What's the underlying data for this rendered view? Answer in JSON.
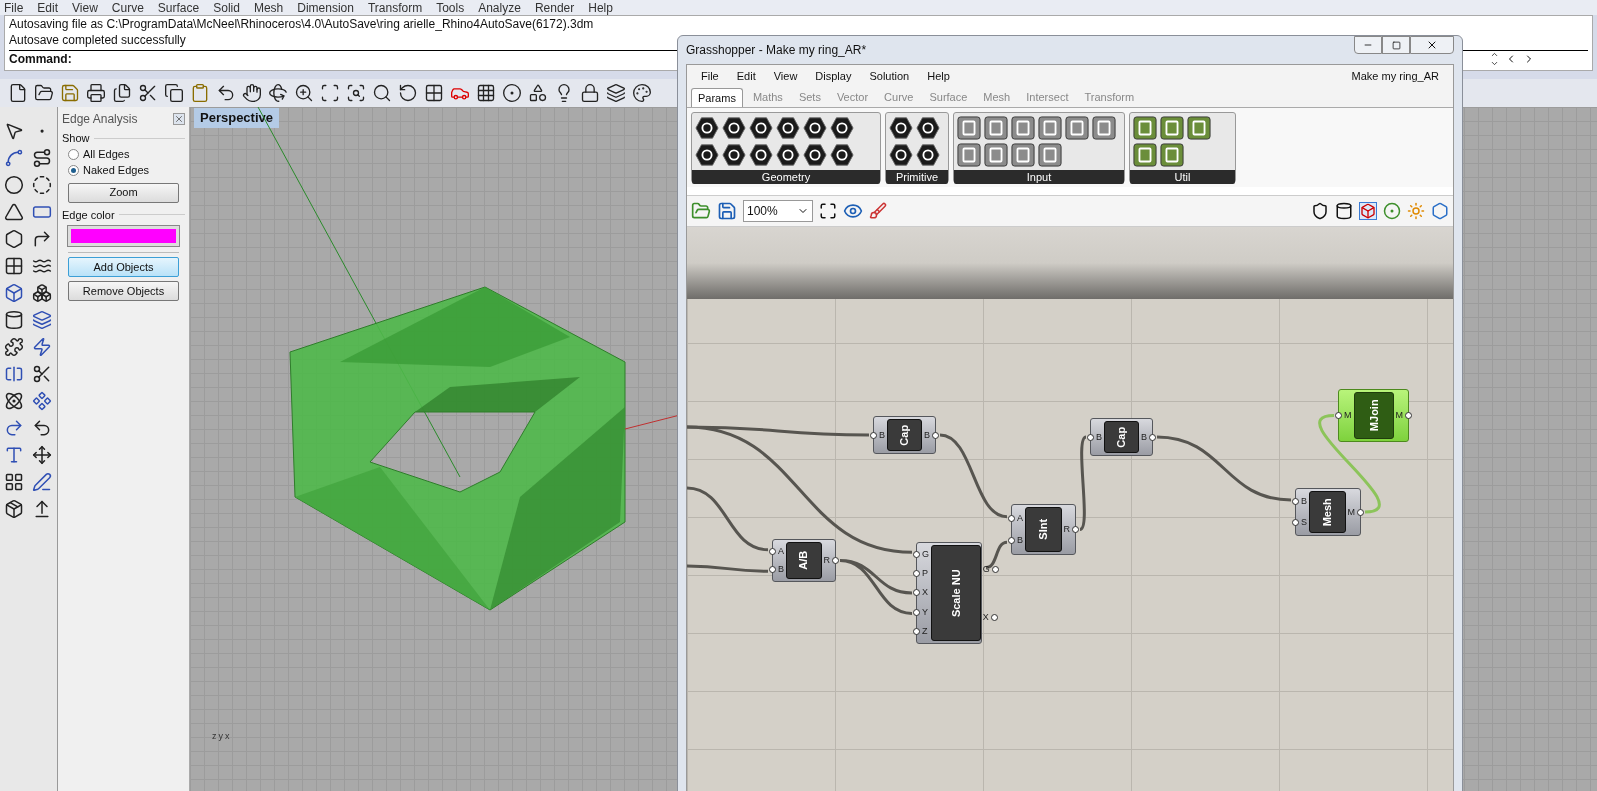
{
  "menu_bar": [
    "File",
    "Edit",
    "View",
    "Curve",
    "Surface",
    "Solid",
    "Mesh",
    "Dimension",
    "Transform",
    "Tools",
    "Analyze",
    "Render",
    "Help"
  ],
  "command_history": [
    "Autosaving file as C:\\ProgramData\\McNeel\\Rhinoceros\\4.0\\AutoSave\\ring arielle_Rhino4AutoSave(6172).3dm",
    "Autosave completed successfully"
  ],
  "command_prompt": "Command:",
  "edge_analysis": {
    "title": "Edge Analysis",
    "show_label": "Show",
    "options": [
      {
        "label": "All Edges",
        "selected": false
      },
      {
        "label": "Naked Edges",
        "selected": true
      }
    ],
    "zoom_button": "Zoom",
    "edge_color_label": "Edge color",
    "edge_color_swatch": {
      "color": "#ff00ff"
    },
    "buttons": [
      {
        "label": "Add Objects",
        "focused": true
      },
      {
        "label": "Remove Objects",
        "focused": false
      }
    ]
  },
  "viewport": {
    "title": "Perspective",
    "axes": [
      "z",
      "y",
      "x"
    ]
  },
  "grasshopper": {
    "title": "Grasshopper - Make my ring_AR*",
    "menu": [
      "File",
      "Edit",
      "View",
      "Display",
      "Solution",
      "Help"
    ],
    "document_name": "Make my ring_AR",
    "tabs": [
      {
        "label": "Params",
        "selected": true
      },
      {
        "label": "Maths",
        "selected": false
      },
      {
        "label": "Sets",
        "selected": false
      },
      {
        "label": "Vector",
        "selected": false
      },
      {
        "label": "Curve",
        "selected": false
      },
      {
        "label": "Surface",
        "selected": false
      },
      {
        "label": "Mesh",
        "selected": false
      },
      {
        "label": "Intersect",
        "selected": false
      },
      {
        "label": "Transform",
        "selected": false
      }
    ],
    "ribbon_groups": [
      "Geometry",
      "Primitive",
      "Input",
      "Util"
    ],
    "zoom": "100%",
    "nodes": [
      {
        "name": "Cap",
        "inputs": [
          "B"
        ],
        "outputs": [
          "B"
        ],
        "selected": false
      },
      {
        "name": "Cap",
        "inputs": [
          "B"
        ],
        "outputs": [
          "B"
        ],
        "selected": false
      },
      {
        "name": "MJoin",
        "inputs": [
          "M"
        ],
        "outputs": [
          "M"
        ],
        "selected": true
      },
      {
        "name": "A/B",
        "inputs": [
          "A",
          "B"
        ],
        "outputs": [
          "R"
        ],
        "selected": false
      },
      {
        "name": "Scale NU",
        "inputs": [
          "G",
          "P",
          "X",
          "Y",
          "Z"
        ],
        "outputs": [
          "G",
          "X"
        ],
        "selected": false
      },
      {
        "name": "SInt",
        "inputs": [
          "A",
          "B"
        ],
        "outputs": [
          "R"
        ],
        "selected": false
      },
      {
        "name": "Mesh",
        "inputs": [
          "B",
          "S"
        ],
        "outputs": [
          "M"
        ],
        "selected": false
      }
    ]
  }
}
